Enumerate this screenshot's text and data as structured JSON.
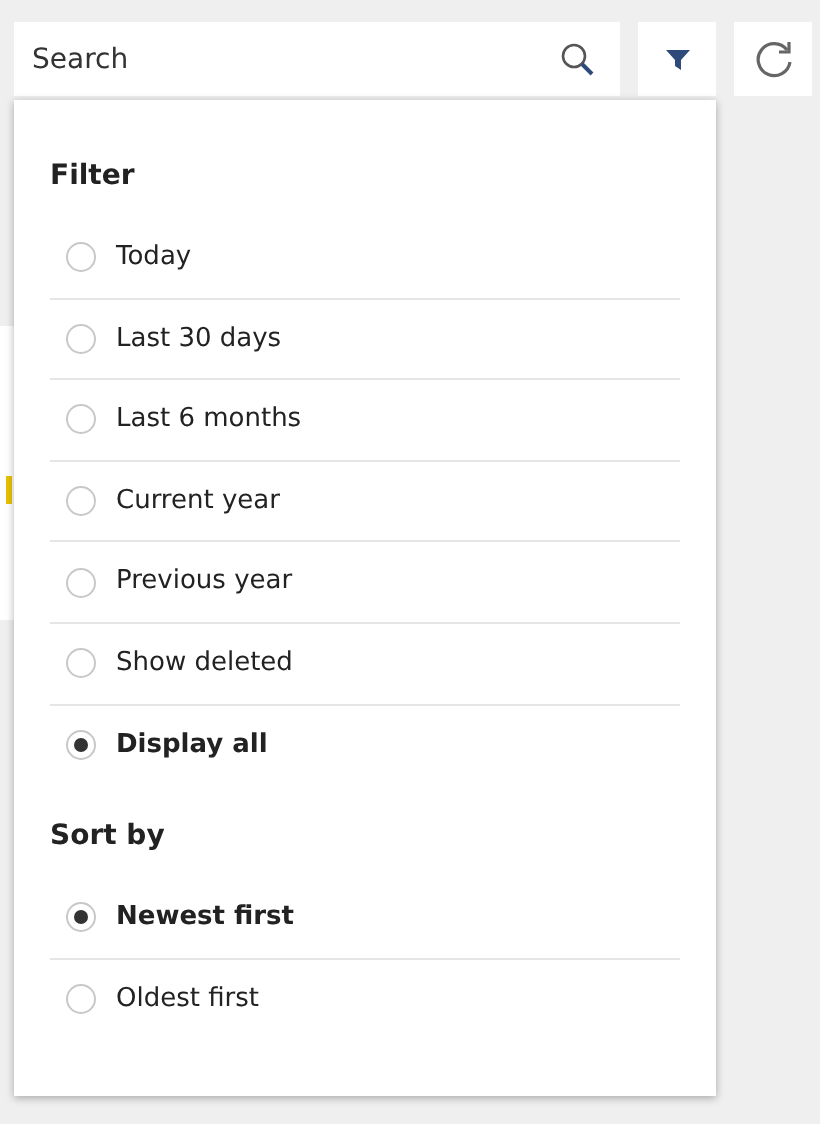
{
  "search": {
    "placeholder": "Search"
  },
  "sections": [
    {
      "title": "Filter",
      "options": [
        {
          "label": "Today",
          "selected": false
        },
        {
          "label": "Last 30 days",
          "selected": false
        },
        {
          "label": "Last 6 months",
          "selected": false
        },
        {
          "label": "Current year",
          "selected": false
        },
        {
          "label": "Previous year",
          "selected": false
        },
        {
          "label": "Show deleted",
          "selected": false
        },
        {
          "label": "Display all",
          "selected": true
        }
      ]
    },
    {
      "title": "Sort by",
      "options": [
        {
          "label": "Newest first",
          "selected": true
        },
        {
          "label": "Oldest first",
          "selected": false
        }
      ]
    }
  ]
}
